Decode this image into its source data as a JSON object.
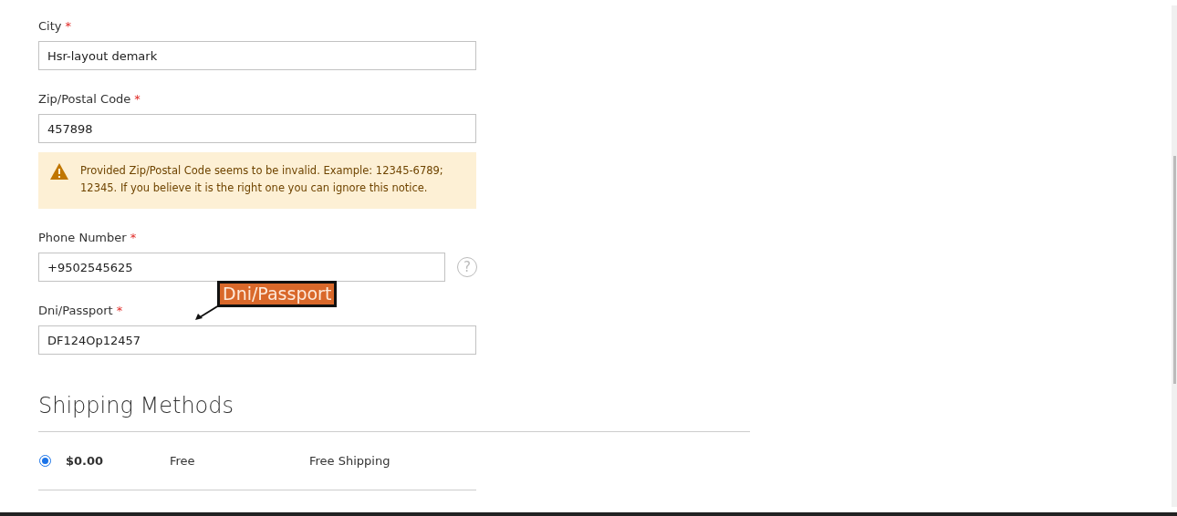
{
  "fields": [
    {
      "label": "City",
      "required_mark": "*",
      "value": "Hsr-layout demark",
      "kind": "text"
    },
    {
      "label": "Zip/Postal Code",
      "required_mark": "*",
      "value": "457898",
      "kind": "text",
      "notice": "Provided Zip/Postal Code seems to be invalid. Example: 12345-6789; 12345. If you believe it is the right one you can ignore this notice."
    },
    {
      "label": "Phone Number",
      "required_mark": "*",
      "value": "+9502545625",
      "kind": "help",
      "help_icon": "?"
    },
    {
      "label": "Dni/Passport",
      "required_mark": "*",
      "value": "DF124Op12457",
      "kind": "text",
      "callout": "Dni/Passport"
    }
  ],
  "shipping": {
    "title": "Shipping Methods",
    "methods": [
      {
        "selected": true,
        "price": "$0.00",
        "method": "Free",
        "carrier": "Free Shipping"
      }
    ]
  }
}
